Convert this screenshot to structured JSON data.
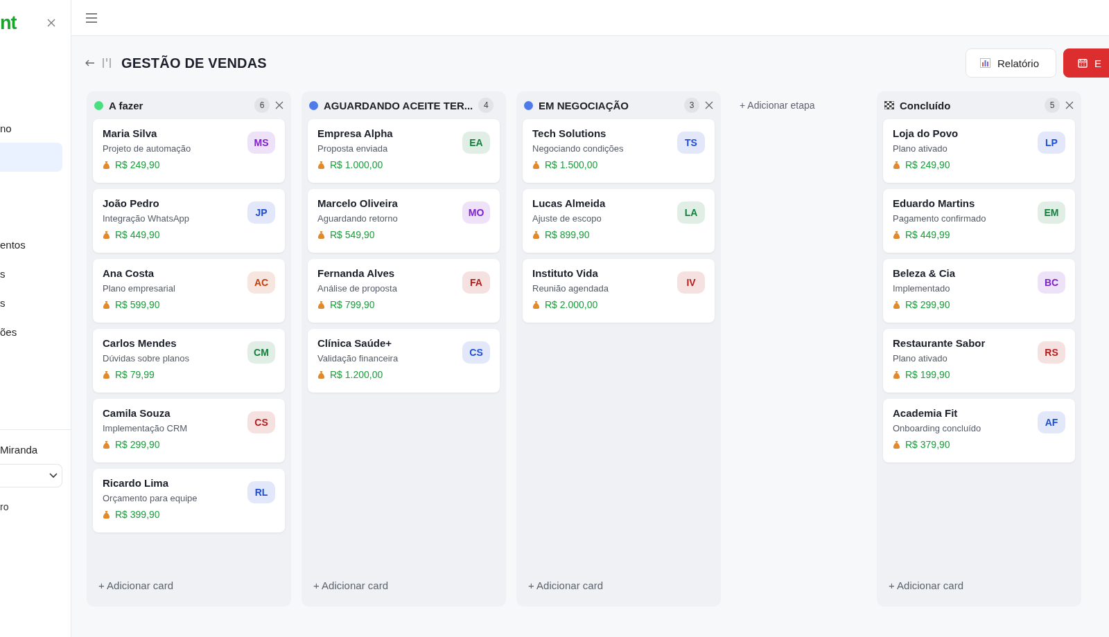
{
  "sidebar": {
    "logo": "nt",
    "items": [
      {
        "label": "no",
        "selected": false
      },
      {
        "selected": true
      },
      {
        "label": "entos",
        "selected": false
      },
      {
        "label": "s",
        "selected": false
      },
      {
        "label": "s",
        "selected": false
      },
      {
        "label": "ões",
        "selected": false
      }
    ],
    "user": "Miranda",
    "footer_link": "ro"
  },
  "page": {
    "title": "GESTÃO DE VENDAS",
    "buttons": [
      {
        "label": "Relatório",
        "kind": "outline"
      },
      {
        "label": "E",
        "kind": "primary"
      }
    ]
  },
  "columns": [
    {
      "title": "A fazer",
      "kind": "dot",
      "color": "#4ade80",
      "count": "6",
      "add_label": "+ Adicionar card",
      "cards": [
        {
          "name": "Maria Silva",
          "subtitle": "Projeto de automação",
          "amount": "R$ 249,90",
          "initials": "MS",
          "color": "#7e22ce"
        },
        {
          "name": "João Pedro",
          "subtitle": "Integração WhatsApp",
          "amount": "R$ 449,90",
          "initials": "JP",
          "color": "#1d4ed8"
        },
        {
          "name": "Ana Costa",
          "subtitle": "Plano empresarial",
          "amount": "R$ 599,90",
          "initials": "AC",
          "color": "#c2410c"
        },
        {
          "name": "Carlos Mendes",
          "subtitle": "Dúvidas sobre planos",
          "amount": "R$ 79,99",
          "initials": "CM",
          "color": "#15803d"
        },
        {
          "name": "Camila Souza",
          "subtitle": "Implementação CRM",
          "amount": "R$ 299,90",
          "initials": "CS",
          "color": "#b91c1c"
        },
        {
          "name": "Ricardo Lima",
          "subtitle": "Orçamento para equipe",
          "amount": "R$ 399,90",
          "initials": "RL",
          "color": "#1d4ed8"
        }
      ]
    },
    {
      "title": "AGUARDANDO ACEITE TER...",
      "kind": "dot",
      "color": "#4f7be8",
      "count": "4",
      "add_label": "+ Adicionar card",
      "cards": [
        {
          "name": "Empresa Alpha",
          "subtitle": "Proposta enviada",
          "amount": "R$ 1.000,00",
          "initials": "EA",
          "color": "#15803d"
        },
        {
          "name": "Marcelo Oliveira",
          "subtitle": "Aguardando retorno",
          "amount": "R$ 549,90",
          "initials": "MO",
          "color": "#7e22ce"
        },
        {
          "name": "Fernanda Alves",
          "subtitle": "Análise de proposta",
          "amount": "R$ 799,90",
          "initials": "FA",
          "color": "#b91c1c"
        },
        {
          "name": "Clínica Saúde+",
          "subtitle": "Validação financeira",
          "amount": "R$ 1.200,00",
          "initials": "CS",
          "color": "#1d4ed8"
        }
      ]
    },
    {
      "title": "EM NEGOCIAÇÃO",
      "kind": "dot",
      "color": "#4f7be8",
      "count": "3",
      "add_label": "+ Adicionar card",
      "cards": [
        {
          "name": "Tech Solutions",
          "subtitle": "Negociando condições",
          "amount": "R$ 1.500,00",
          "initials": "TS",
          "color": "#1d4ed8"
        },
        {
          "name": "Lucas Almeida",
          "subtitle": "Ajuste de escopo",
          "amount": "R$ 899,90",
          "initials": "LA",
          "color": "#15803d"
        },
        {
          "name": "Instituto Vida",
          "subtitle": "Reunião agendada",
          "amount": "R$ 2.000,00",
          "initials": "IV",
          "color": "#b91c1c"
        }
      ]
    },
    {
      "kind": "add_stage",
      "title": "+ Adicionar etapa"
    },
    {
      "title": "Concluído",
      "kind": "flag",
      "count": "5",
      "add_label": "+ Adicionar card",
      "cards": [
        {
          "name": "Loja do Povo",
          "subtitle": "Plano ativado",
          "amount": "R$ 249,90",
          "initials": "LP",
          "color": "#1d4ed8"
        },
        {
          "name": "Eduardo Martins",
          "subtitle": "Pagamento confirmado",
          "amount": "R$ 449,99",
          "initials": "EM",
          "color": "#15803d"
        },
        {
          "name": "Beleza & Cia",
          "subtitle": "Implementado",
          "amount": "R$ 299,90",
          "initials": "BC",
          "color": "#7e22ce"
        },
        {
          "name": "Restaurante Sabor",
          "subtitle": "Plano ativado",
          "amount": "R$ 199,90",
          "initials": "RS",
          "color": "#b91c1c"
        },
        {
          "name": "Academia Fit",
          "subtitle": "Onboarding concluído",
          "amount": "R$ 379,90",
          "initials": "AF",
          "color": "#1d4ed8"
        }
      ]
    }
  ]
}
